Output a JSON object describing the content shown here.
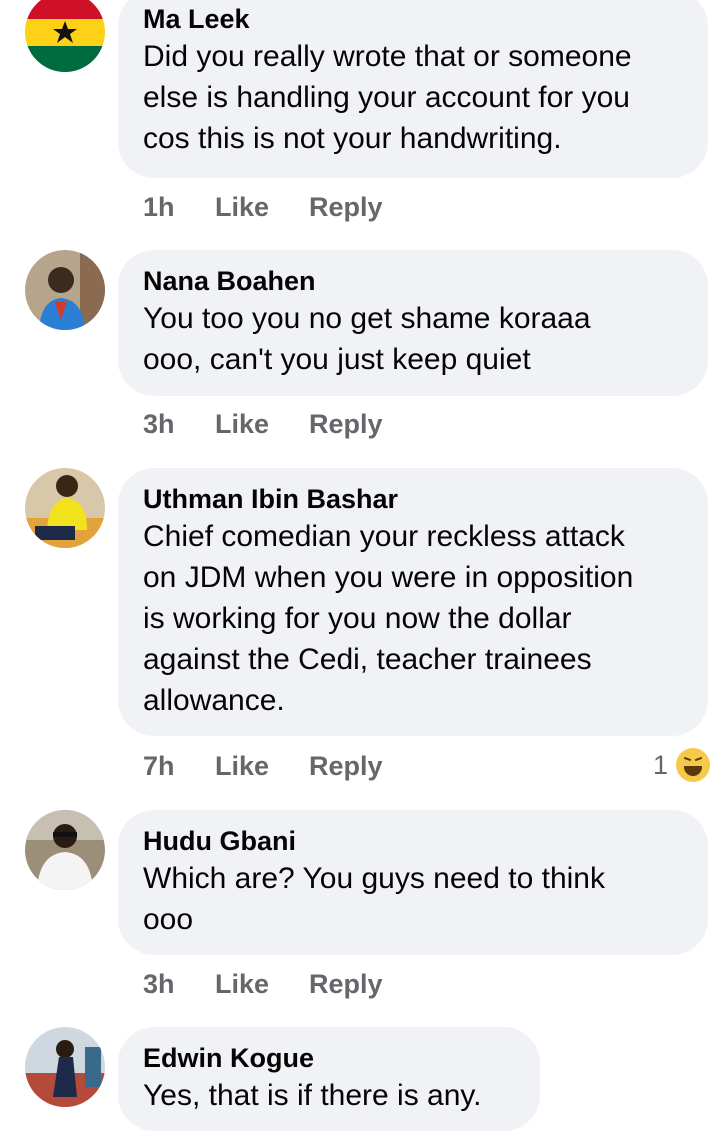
{
  "comments": [
    {
      "author": "Ma Leek",
      "text": "Did you really wrote that or someone\nelse is handling your account for you\ncos this is not your handwriting.",
      "time": "1h",
      "like": "Like",
      "reply": "Reply"
    },
    {
      "author": "Nana Boahen",
      "text": "You too you no get shame koraaa\nooo, can't you just keep quiet",
      "time": "3h",
      "like": "Like",
      "reply": "Reply"
    },
    {
      "author": "Uthman Ibin Bashar",
      "text": "Chief comedian your reckless attack\non JDM when you were in opposition\nis working for you now the dollar\nagainst the Cedi, teacher trainees\nallowance.",
      "time": "7h",
      "like": "Like",
      "reply": "Reply",
      "reaction_count": "1"
    },
    {
      "author": "Hudu Gbani",
      "text": "Which are? You guys need to think\nooo",
      "time": "3h",
      "like": "Like",
      "reply": "Reply"
    },
    {
      "author": "Edwin Kogue",
      "text": "Yes, that is if there is any.",
      "time": "",
      "like": "",
      "reply": ""
    }
  ],
  "colors": {
    "bubble": "#f0f2f5",
    "meta_text": "#65676b",
    "ghana_red": "#ce1126",
    "ghana_gold": "#fcd116",
    "ghana_green": "#006b3f"
  },
  "icons": [
    "ghana-flag-avatar",
    "laughing-emoji-icon"
  ]
}
